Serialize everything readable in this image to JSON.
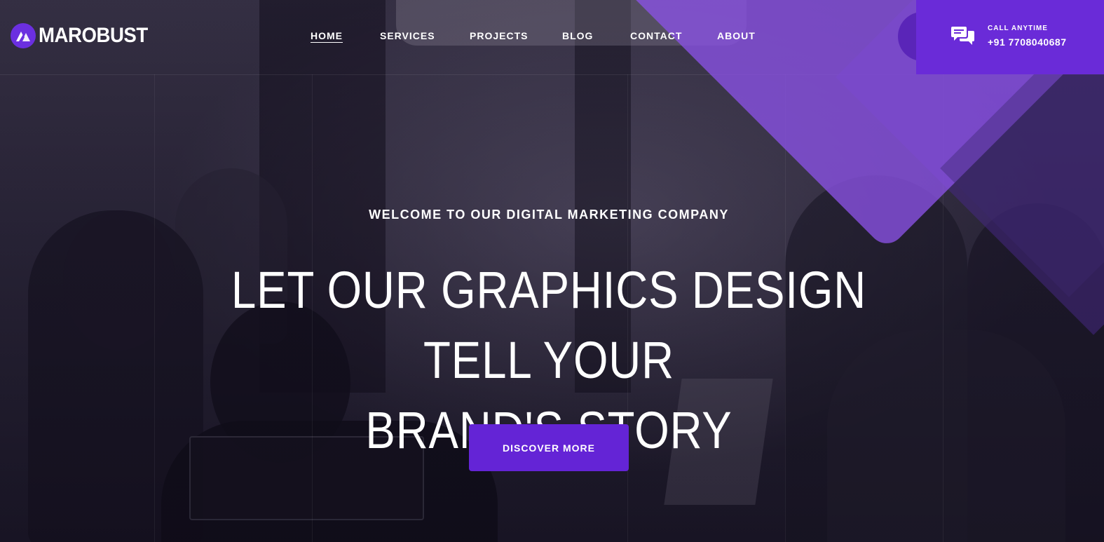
{
  "brand": {
    "name": "MAROBUST",
    "logo_icon": "marobust-logo-icon",
    "accent_color": "#6424d6"
  },
  "nav": {
    "items": [
      {
        "label": "HOME",
        "active": true
      },
      {
        "label": "SERVICES",
        "active": false
      },
      {
        "label": "PROJECTS",
        "active": false
      },
      {
        "label": "BLOG",
        "active": false
      },
      {
        "label": "CONTACT",
        "active": false
      },
      {
        "label": "ABOUT",
        "active": false
      }
    ]
  },
  "call": {
    "icon": "chat-bubbles-icon",
    "label": "CALL ANYTIME",
    "phone": "+91 7708040687"
  },
  "hero": {
    "kicker": "WELCOME TO OUR DIGITAL MARKETING COMPANY",
    "headline_line1": "LET OUR GRAPHICS DESIGN TELL YOUR",
    "headline_line2": "BRAND'S STORY",
    "cta_label": "DISCOVER MORE"
  }
}
